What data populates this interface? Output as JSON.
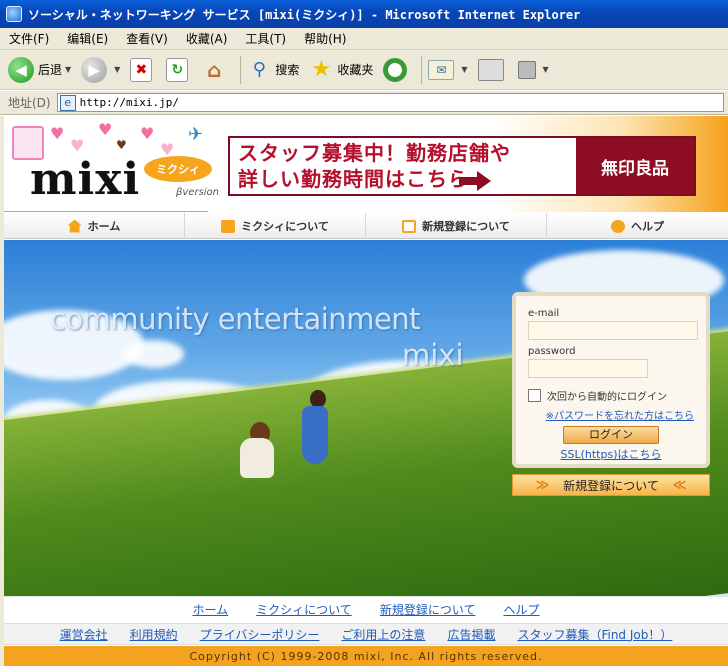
{
  "window": {
    "title": "ソーシャル・ネットワーキング サービス [mixi(ミクシィ)] - Microsoft Internet Explorer"
  },
  "menu": {
    "items": [
      "文件(F)",
      "编辑(E)",
      "查看(V)",
      "收藏(A)",
      "工具(T)",
      "帮助(H)"
    ]
  },
  "toolbar": {
    "back_label": "后退",
    "search_label": "搜索",
    "favorites_label": "收藏夹"
  },
  "address": {
    "label": "地址(D)",
    "url": "http://mixi.jp/"
  },
  "header": {
    "logo_text": "mixi",
    "logo_kana": "ミクシィ",
    "logo_version": "βversion",
    "banner_line1": "スタッフ募集中！勤務店舗や",
    "banner_line2": "詳しい勤務時間はこちら",
    "banner_brand": "無印良品"
  },
  "nav": {
    "items": [
      "ホーム",
      "ミクシィについて",
      "新規登録について",
      "ヘルプ"
    ]
  },
  "hero": {
    "tagline": "community entertainment",
    "brand": "mixi"
  },
  "login": {
    "email_label": "e-mail",
    "email_value": "",
    "password_label": "password",
    "password_value": "",
    "remember_label": "次回から自動的にログイン",
    "forgot_link": "※パスワードを忘れた方はこちら",
    "login_button": "ログイン",
    "ssl_link": "SSL(https)はこちら",
    "register_button": "新規登録について"
  },
  "footer": {
    "nav_links": [
      "ホーム",
      "ミクシィについて",
      "新規登録について",
      "ヘルプ"
    ],
    "links": [
      "運営会社",
      "利用規約",
      "プライバシーポリシー",
      "ご利用上の注意",
      "広告掲載",
      "スタッフ募集（Find Job！）"
    ],
    "copyright": "Copyright (C) 1999-2008 mixi, Inc. All rights reserved."
  },
  "colors": {
    "accent_orange": "#f3a31f",
    "link_blue": "#1f5bb8",
    "banner_red": "#8d0e22",
    "titlebar_blue": "#0a5fd8"
  },
  "icons": [
    "app-icon",
    "back-icon",
    "forward-icon",
    "stop-icon",
    "refresh-icon",
    "home-icon",
    "search-icon",
    "favorites-icon",
    "history-icon",
    "mail-icon",
    "print-icon",
    "edit-icon",
    "page-icon",
    "home-nav-icon",
    "about-nav-icon",
    "register-nav-icon",
    "help-nav-icon",
    "arrow-icon",
    "chevron-icon"
  ]
}
